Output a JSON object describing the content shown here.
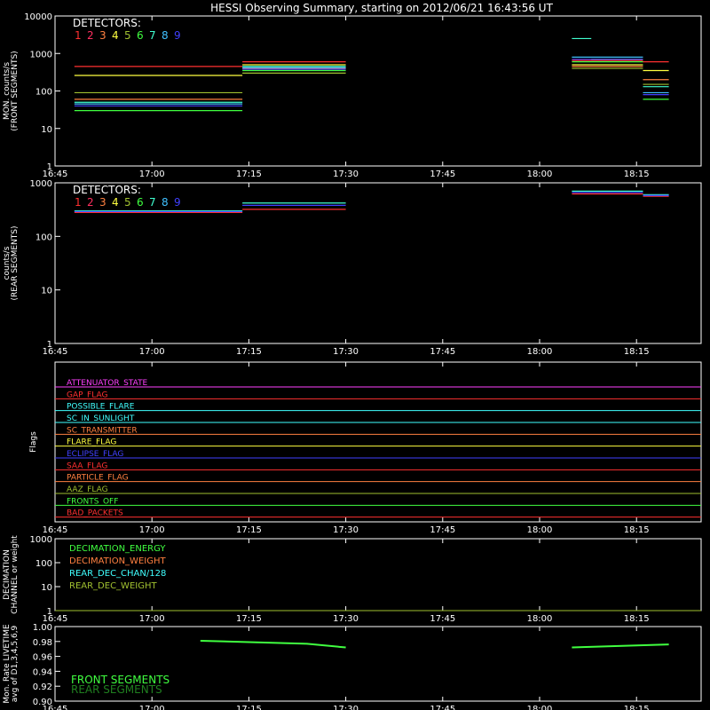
{
  "title": "HESSI Observing Summary, starting on 2012/06/21 16:43:56 UT",
  "x_ticks": [
    "16:45",
    "17:00",
    "17:15",
    "17:30",
    "17:45",
    "18:00",
    "18:15"
  ],
  "colors": {
    "det": [
      "#ff3030",
      "#ff3060",
      "#ff8040",
      "#ffff40",
      "#a0c030",
      "#40ff40",
      "#40ffd0",
      "#40c0ff",
      "#4040ff"
    ]
  },
  "chart_data": [
    {
      "type": "line",
      "panel": "front",
      "ylabel": [
        "MON. counts/s",
        "(FRONT SEGMENTS)"
      ],
      "y_scale": "log",
      "ylim": [
        1,
        10000
      ],
      "y_ticks": [
        "1",
        "10",
        "100",
        "1000",
        "10000"
      ],
      "legend_title": "DETECTORS:",
      "legend_numbers": [
        "1",
        "2",
        "3",
        "4",
        "5",
        "6",
        "7",
        "8",
        "9"
      ],
      "x_range_minutes": [
        0,
        100
      ],
      "segments": [
        [
          0,
          23.5
        ],
        [
          33,
          46
        ],
        [
          81,
          96
        ]
      ],
      "series": [
        {
          "det": "1",
          "levels": [
            [
              4,
              450
            ],
            [
              30,
              600
            ],
            [
              46,
              0
            ],
            [
              81,
              650
            ],
            [
              92,
              600
            ]
          ]
        },
        {
          "det": "4",
          "levels": [
            [
              4,
              260
            ],
            [
              30,
              500
            ],
            [
              46,
              0
            ],
            [
              81,
              500
            ],
            [
              92,
              350
            ]
          ]
        },
        {
          "det": "5",
          "levels": [
            [
              4,
              90
            ],
            [
              30,
              300
            ],
            [
              46,
              0
            ],
            [
              81,
              400
            ],
            [
              92,
              150
            ]
          ]
        },
        {
          "det": "3",
          "levels": [
            [
              4,
              60
            ],
            [
              30,
              400
            ],
            [
              46,
              0
            ],
            [
              81,
              450
            ],
            [
              92,
              200
            ]
          ]
        },
        {
          "det": "7",
          "levels": [
            [
              4,
              50
            ],
            [
              30,
              450
            ],
            [
              46,
              0
            ],
            [
              81,
              2500
            ],
            [
              84,
              700
            ],
            [
              92,
              130
            ]
          ]
        },
        {
          "det": "8",
          "levels": [
            [
              4,
              45
            ],
            [
              30,
              420
            ],
            [
              46,
              0
            ],
            [
              81,
              800
            ],
            [
              92,
              90
            ]
          ]
        },
        {
          "det": "9",
          "levels": [
            [
              4,
              40
            ],
            [
              30,
              380
            ],
            [
              46,
              0
            ],
            [
              81,
              700
            ],
            [
              92,
              80
            ]
          ]
        },
        {
          "det": "6",
          "levels": [
            [
              4,
              30
            ],
            [
              30,
              350
            ],
            [
              46,
              0
            ],
            [
              81,
              600
            ],
            [
              92,
              60
            ]
          ]
        }
      ]
    },
    {
      "type": "line",
      "panel": "rear",
      "ylabel": [
        "counts/s",
        "(REAR SEGMENTS)"
      ],
      "y_scale": "log",
      "ylim": [
        1,
        1000
      ],
      "y_ticks": [
        "1",
        "10",
        "100",
        "1000"
      ],
      "legend_title": "DETECTORS:",
      "legend_numbers": [
        "1",
        "2",
        "3",
        "4",
        "5",
        "6",
        "7",
        "8",
        "9"
      ],
      "series": [
        {
          "det": "1",
          "levels": [
            [
              4,
              280
            ],
            [
              30,
              320
            ],
            [
              46,
              0
            ],
            [
              81,
              620
            ],
            [
              92,
              560
            ]
          ]
        },
        {
          "det": "7",
          "levels": [
            [
              4,
              300
            ],
            [
              30,
              420
            ],
            [
              46,
              0
            ],
            [
              81,
              700
            ],
            [
              92,
              600
            ]
          ]
        },
        {
          "det": "9",
          "levels": [
            [
              4,
              290
            ],
            [
              30,
              380
            ],
            [
              46,
              0
            ],
            [
              81,
              660
            ],
            [
              92,
              580
            ]
          ]
        }
      ]
    },
    {
      "type": "table",
      "panel": "flags",
      "ylabel": "Flags",
      "flags": [
        {
          "label": "ATTENUATOR_STATE",
          "color": "#ff40ff"
        },
        {
          "label": "GAP_FLAG",
          "color": "#ff3030"
        },
        {
          "label": "POSSIBLE_FLARE",
          "color": "#40ffff"
        },
        {
          "label": "SC_IN_SUNLIGHT",
          "color": "#40ffff"
        },
        {
          "label": "SC_TRANSMITTER",
          "color": "#ff8040"
        },
        {
          "label": "FLARE_FLAG",
          "color": "#ffff40"
        },
        {
          "label": "ECLIPSE_FLAG",
          "color": "#4040ff"
        },
        {
          "label": "SAA_FLAG",
          "color": "#ff3030"
        },
        {
          "label": "PARTICLE_FLAG",
          "color": "#ff8040"
        },
        {
          "label": "AAZ_FLAG",
          "color": "#a0c030"
        },
        {
          "label": "FRONTS_OFF",
          "color": "#40ff40"
        },
        {
          "label": "BAD_PACKETS",
          "color": "#ff3030"
        }
      ]
    },
    {
      "type": "line",
      "panel": "decimation",
      "ylabel": [
        "DECIMATION",
        "CHANNEL or weight"
      ],
      "y_scale": "log",
      "ylim": [
        1,
        1000
      ],
      "y_ticks": [
        "1",
        "10",
        "100",
        "1000"
      ],
      "legend": [
        {
          "label": "DECIMATION_ENERGY",
          "color": "#40ff40"
        },
        {
          "label": "DECIMATION_WEIGHT",
          "color": "#ff8040"
        },
        {
          "label": "REAR_DEC_CHAN/128",
          "color": "#40ffff"
        },
        {
          "label": "REAR_DEC_WEIGHT",
          "color": "#a0c030"
        }
      ]
    },
    {
      "type": "line",
      "panel": "livetime",
      "ylabel": [
        "Mon. Rate LIVETIME",
        "avg of D1,3,4,5,6,9"
      ],
      "ylim": [
        0.9,
        1.0
      ],
      "y_ticks": [
        "0.90",
        "0.92",
        "0.94",
        "0.96",
        "0.98",
        "1.00"
      ],
      "legend": [
        {
          "label": "FRONT SEGMENTS",
          "color": "#40ff40"
        },
        {
          "label": "REAR SEGMENTS",
          "color": "#208020"
        }
      ]
    }
  ]
}
